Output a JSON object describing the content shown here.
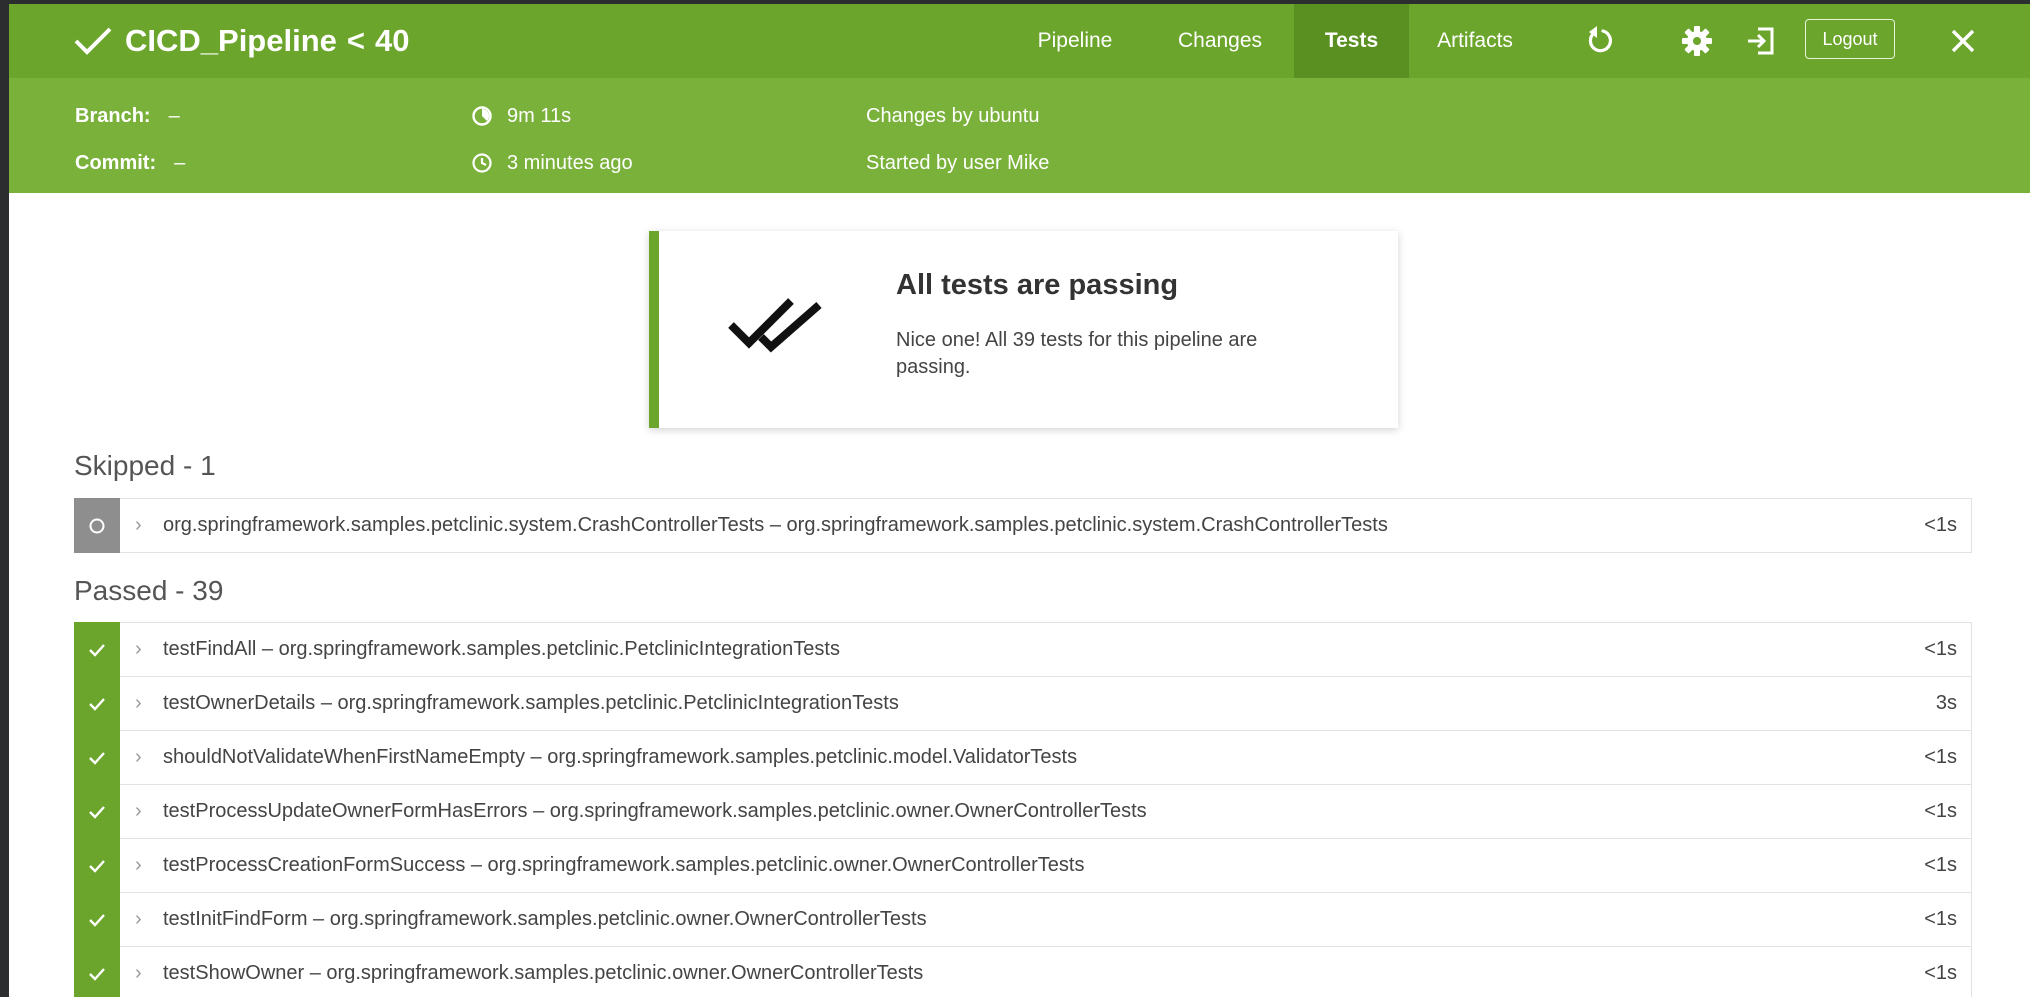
{
  "header": {
    "pipeline_name": "CICD_Pipeline",
    "separator": "<",
    "run_number": "40",
    "nav": [
      {
        "label": "Pipeline",
        "active": false
      },
      {
        "label": "Changes",
        "active": false
      },
      {
        "label": "Tests",
        "active": true
      },
      {
        "label": "Artifacts",
        "active": false
      }
    ],
    "icons": [
      "replay-icon",
      "gear-icon",
      "sign-in-icon",
      "close-icon"
    ],
    "logout_label": "Logout"
  },
  "meta": {
    "branch_label": "Branch:",
    "branch_value": "–",
    "commit_label": "Commit:",
    "commit_value": "–",
    "duration": "9m 11s",
    "started": "3 minutes ago",
    "changes": "Changes by ubuntu",
    "started_by": "Started by user Mike"
  },
  "summary": {
    "title": "All tests are passing",
    "text": "Nice one! All 39 tests for this pipeline are passing."
  },
  "skipped": {
    "title": "Skipped - 1",
    "rows": [
      {
        "name": "org.springframework.samples.petclinic.system.CrashControllerTests – org.springframework.samples.petclinic.system.CrashControllerTests",
        "duration": "<1s"
      }
    ]
  },
  "passed": {
    "title": "Passed - 39",
    "rows": [
      {
        "name": "testFindAll – org.springframework.samples.petclinic.PetclinicIntegrationTests",
        "duration": "<1s"
      },
      {
        "name": "testOwnerDetails – org.springframework.samples.petclinic.PetclinicIntegrationTests",
        "duration": "3s"
      },
      {
        "name": "shouldNotValidateWhenFirstNameEmpty – org.springframework.samples.petclinic.model.ValidatorTests",
        "duration": "<1s"
      },
      {
        "name": "testProcessUpdateOwnerFormHasErrors – org.springframework.samples.petclinic.owner.OwnerControllerTests",
        "duration": "<1s"
      },
      {
        "name": "testProcessCreationFormSuccess – org.springframework.samples.petclinic.owner.OwnerControllerTests",
        "duration": "<1s"
      },
      {
        "name": "testInitFindForm – org.springframework.samples.petclinic.owner.OwnerControllerTests",
        "duration": "<1s"
      },
      {
        "name": "testShowOwner – org.springframework.samples.petclinic.owner.OwnerControllerTests",
        "duration": "<1s"
      }
    ]
  },
  "colors": {
    "header_green": "#6ba52c",
    "meta_green": "#79b13a",
    "active_tab": "#5a8f22",
    "skipped_gray": "#8e8e8e"
  }
}
